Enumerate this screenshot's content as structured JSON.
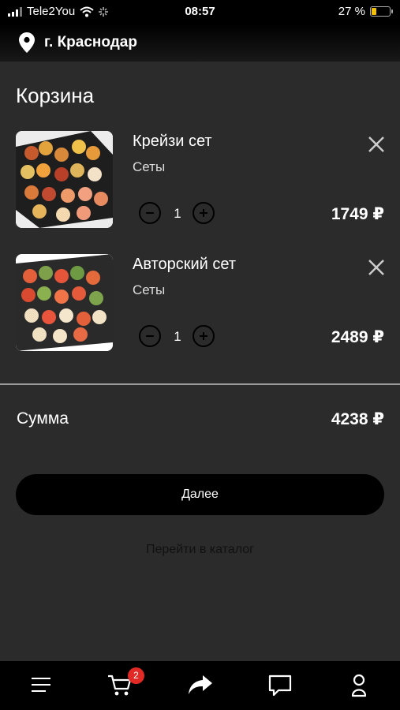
{
  "status": {
    "carrier": "Tele2You",
    "time": "08:57",
    "battery": "27 %",
    "battery_level": 0.27
  },
  "header": {
    "city": "г. Краснодар"
  },
  "page": {
    "title": "Корзина"
  },
  "items": [
    {
      "name": "Крейзи сет",
      "category": "Сеты",
      "quantity": "1",
      "price": "1749 ₽"
    },
    {
      "name": "Авторский сет",
      "category": "Сеты",
      "quantity": "1",
      "price": "2489 ₽"
    }
  ],
  "summary": {
    "label": "Сумма",
    "value": "4238 ₽"
  },
  "actions": {
    "next_label": "Далее",
    "catalog_link": "Перейти в каталог"
  },
  "bottom_nav": {
    "cart_count": "2",
    "icons": [
      "menu-icon",
      "cart-icon",
      "share-icon",
      "chat-icon",
      "profile-icon"
    ]
  },
  "colors": {
    "background": "#2b2b2b",
    "bar": "#000000",
    "badge": "#e12a26",
    "battery": "#f4c000"
  }
}
